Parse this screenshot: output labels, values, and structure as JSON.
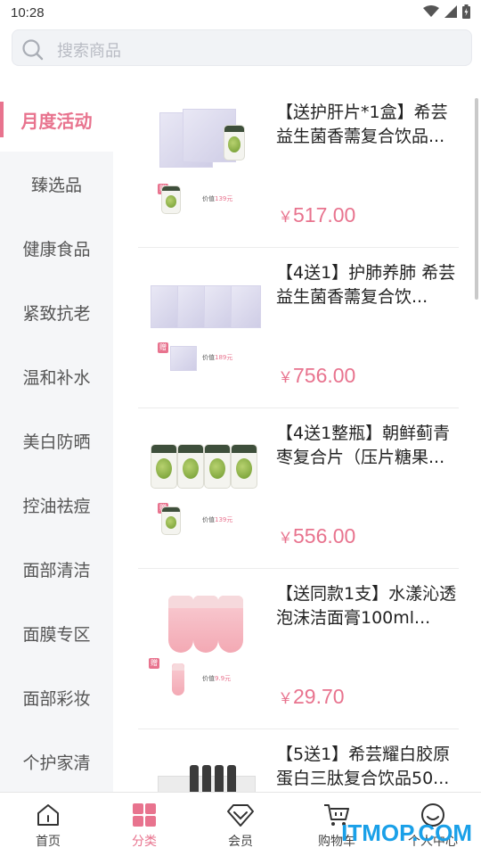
{
  "status_bar": {
    "time": "10:28"
  },
  "search": {
    "placeholder": "搜索商品"
  },
  "sidebar": {
    "items": [
      {
        "label": "月度活动",
        "active": true
      },
      {
        "label": "臻选品"
      },
      {
        "label": "健康食品"
      },
      {
        "label": "紧致抗老"
      },
      {
        "label": "温和补水"
      },
      {
        "label": "美白防晒"
      },
      {
        "label": "控油祛痘"
      },
      {
        "label": "面部清洁"
      },
      {
        "label": "面膜专区"
      },
      {
        "label": "面部彩妆"
      },
      {
        "label": "个护家清"
      }
    ]
  },
  "products": [
    {
      "name": "【送护肝片*1盒】希芸益生菌香薷复合饮品...",
      "currency": "￥",
      "price": "517.00",
      "gift_value_label": "价值",
      "gift_value": "139元",
      "gift_tag": "赠"
    },
    {
      "name": "【4送1】护肺养肺 希芸益生菌香薷复合饮...",
      "currency": "￥",
      "price": "756.00",
      "gift_value_label": "价值",
      "gift_value": "189元",
      "gift_tag": "赠"
    },
    {
      "name": "【4送1整瓶】朝鲜蓟青枣复合片（压片糖果...",
      "currency": "￥",
      "price": "556.00",
      "gift_value_label": "价值",
      "gift_value": "139元",
      "gift_tag": "赠"
    },
    {
      "name": "【送同款1支】水漾沁透泡沫洁面膏100ml...",
      "currency": "￥",
      "price": "29.70",
      "gift_value_label": "价值",
      "gift_value": "9.9元",
      "gift_tag": "赠"
    },
    {
      "name": "【5送1】希芸耀白胶原蛋白三肽复合饮品50...",
      "currency": "￥",
      "price": ""
    }
  ],
  "tabbar": {
    "items": [
      {
        "label": "首页"
      },
      {
        "label": "分类",
        "active": true
      },
      {
        "label": "会员"
      },
      {
        "label": "购物车"
      },
      {
        "label": "个人中心"
      }
    ]
  },
  "watermark": "ITMOP.COM",
  "colors": {
    "accent": "#e8738e",
    "sidebar_bg": "#f5f6f8"
  }
}
